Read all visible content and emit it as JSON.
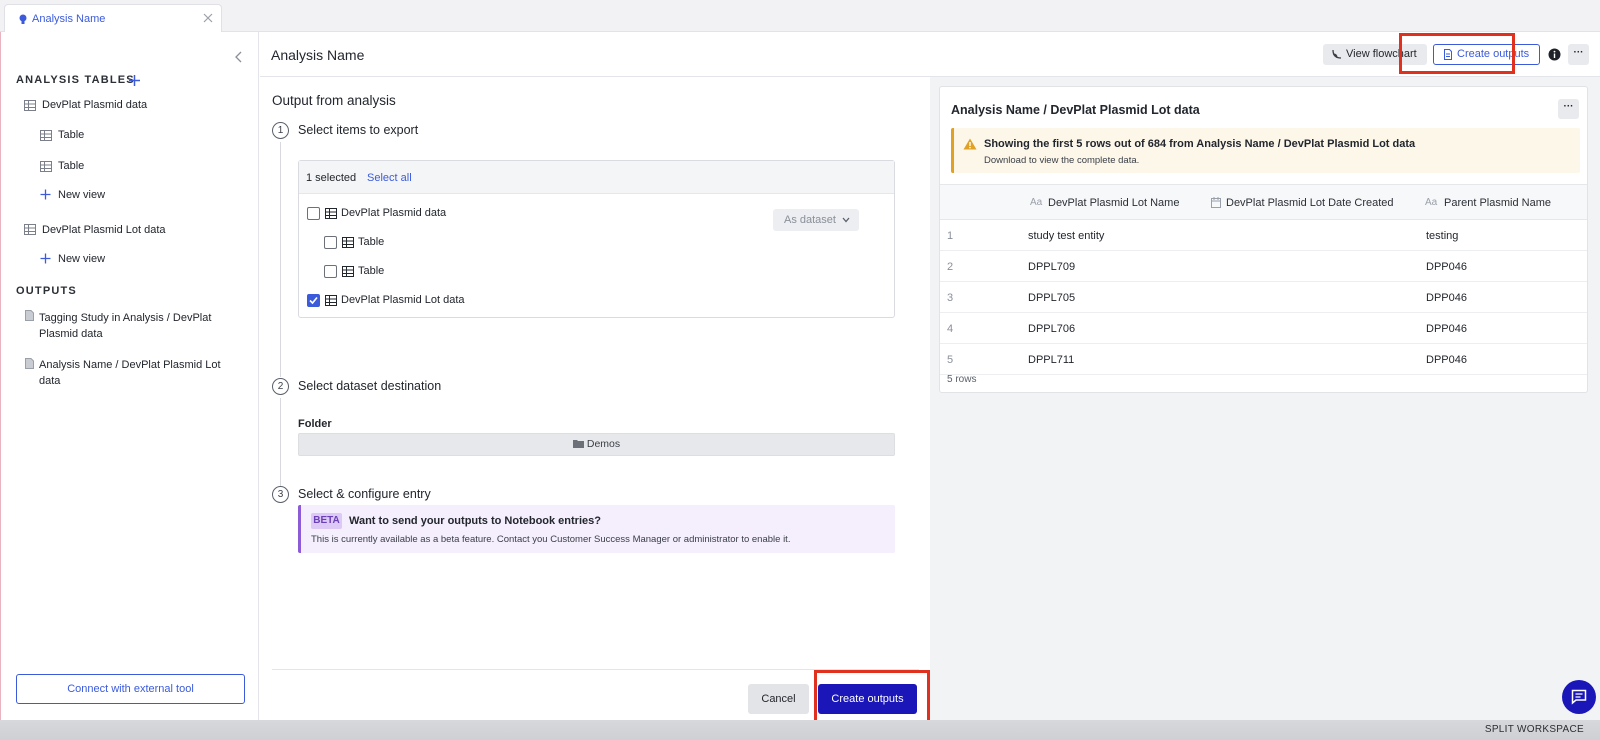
{
  "tab": {
    "title": "Analysis Name"
  },
  "sidebar": {
    "analysis_tables_heading": "ANALYSIS TABLES",
    "tables": [
      {
        "label": "DevPlat Plasmid data",
        "children": [
          "Table",
          "Table"
        ],
        "new_view": "New view"
      },
      {
        "label": "DevPlat Plasmid Lot data",
        "children": [],
        "new_view": "New view"
      }
    ],
    "outputs_heading": "OUTPUTS",
    "outputs": [
      {
        "line1": "Tagging Study in Analysis / DevPlat",
        "line2": "Plasmid data"
      },
      {
        "line1": "Analysis Name / DevPlat Plasmid Lot",
        "line2": "data"
      }
    ],
    "connect_button": "Connect with external tool"
  },
  "header": {
    "title": "Analysis Name",
    "view_flowchart": "View flowchart",
    "create_outputs": "Create outputs",
    "more": "···"
  },
  "output_panel": {
    "title": "Output from analysis",
    "steps": [
      {
        "num": "1",
        "label": "Select items to export"
      },
      {
        "num": "2",
        "label": "Select dataset destination"
      },
      {
        "num": "3",
        "label": "Select & configure entry"
      }
    ],
    "selected_count": "1 selected",
    "select_all": "Select all",
    "export_items": [
      {
        "label": "DevPlat Plasmid data",
        "checked": false,
        "indent": 0
      },
      {
        "label": "Table",
        "checked": false,
        "indent": 1
      },
      {
        "label": "Table",
        "checked": false,
        "indent": 1
      },
      {
        "label": "DevPlat Plasmid Lot data",
        "checked": true,
        "indent": 0
      }
    ],
    "as_dataset": "As dataset",
    "folder_label": "Folder",
    "folder_value": "Demos",
    "beta_tag": "BETA",
    "beta_title": "Want to send your outputs to Notebook entries?",
    "beta_text": "This is currently available as a beta feature. Contact you Customer Success Manager or administrator to enable it.",
    "cancel": "Cancel",
    "create_outputs": "Create outputs"
  },
  "preview": {
    "title": "Analysis Name / DevPlat Plasmid Lot data",
    "more": "···",
    "warning_title": "Showing the first 5 rows out of 684 from Analysis Name / DevPlat Plasmid Lot data",
    "warning_sub": "Download to view the complete data.",
    "columns": [
      {
        "icon": "Aa",
        "label": "DevPlat Plasmid Lot Name"
      },
      {
        "icon": "calendar",
        "label": "DevPlat Plasmid Lot Date Created"
      },
      {
        "icon": "Aa",
        "label": "Parent Plasmid Name"
      }
    ],
    "rows": [
      {
        "idx": "1",
        "name": "study test entity",
        "date": "",
        "parent": "testing"
      },
      {
        "idx": "2",
        "name": "DPPL709",
        "date": "",
        "parent": "DPP046"
      },
      {
        "idx": "3",
        "name": "DPPL705",
        "date": "",
        "parent": "DPP046"
      },
      {
        "idx": "4",
        "name": "DPPL706",
        "date": "",
        "parent": "DPP046"
      },
      {
        "idx": "5",
        "name": "DPPL711",
        "date": "",
        "parent": "DPP046"
      }
    ],
    "row_count": "5 rows"
  },
  "footer": {
    "split_workspace": "SPLIT WORKSPACE"
  },
  "colors": {
    "accent": "#3b5bdb",
    "primary_button": "#1a16b8",
    "highlight": "#e0301e",
    "beta": "#8c5bd6",
    "warning": "#e0a125"
  }
}
